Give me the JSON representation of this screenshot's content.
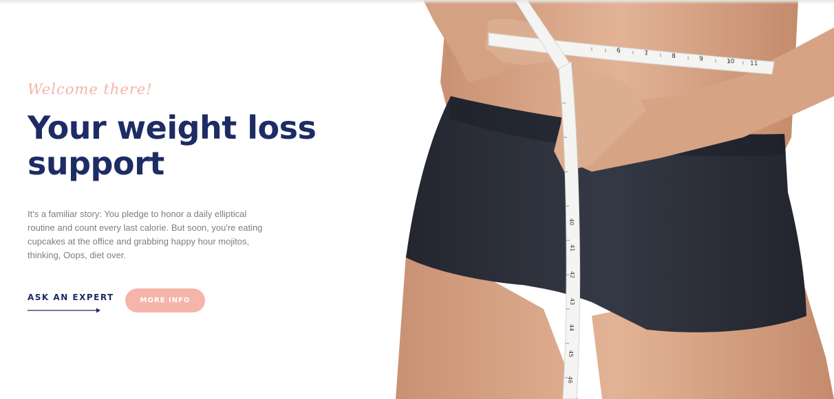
{
  "hero": {
    "welcome": "Welcome there!",
    "title_line1": "Your weight loss",
    "title_line2": "support",
    "description": "It's a familiar story: You pledge to honor a daily elliptical routine and count every last calorie. But soon, you're eating cupcakes at the office and grabbing happy hour mojitos, thinking, Oops, diet over.",
    "ask_label": "ASK AN EXPERT",
    "more_label": "MORE INFO"
  },
  "tape": {
    "horizontal_numbers": [
      "6",
      "7",
      "8",
      "9",
      "10",
      "11"
    ],
    "vertical_numbers": [
      "40",
      "41",
      "42",
      "43",
      "44",
      "45",
      "46"
    ]
  },
  "colors": {
    "navy": "#1d2c64",
    "accent_pink": "#f5b5ab",
    "body_text": "#7b7d83",
    "skin": "#d9a88a",
    "shorts": "#2b2e38"
  }
}
